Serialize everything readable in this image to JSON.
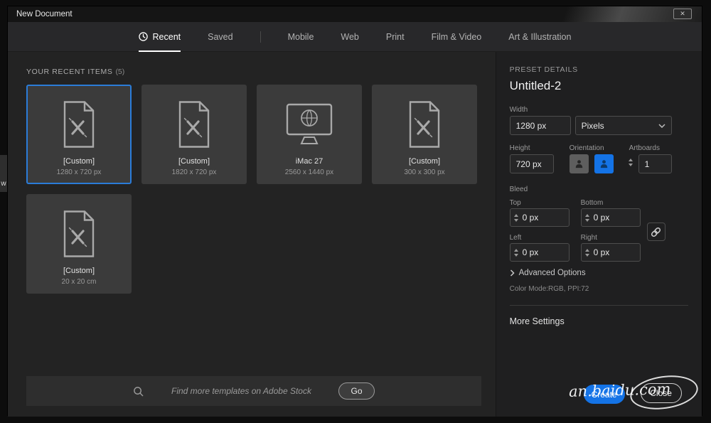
{
  "window": {
    "title": "New Document",
    "close_glyph": "✕"
  },
  "background": {
    "sliver_text": "w"
  },
  "tabs": [
    {
      "label": "Recent",
      "active": true,
      "icon": "clock"
    },
    {
      "label": "Saved",
      "divider_after": true
    },
    {
      "label": "Mobile"
    },
    {
      "label": "Web"
    },
    {
      "label": "Print"
    },
    {
      "label": "Film & Video"
    },
    {
      "label": "Art & Illustration"
    }
  ],
  "recent_section": {
    "heading": "YOUR RECENT ITEMS",
    "count": "(5)",
    "items": [
      {
        "name": "[Custom]",
        "size": "1280 x 720 px",
        "icon": "document",
        "selected": true
      },
      {
        "name": "[Custom]",
        "size": "1820 x 720 px",
        "icon": "document",
        "selected": false
      },
      {
        "name": "iMac 27",
        "size": "2560 x 1440 px",
        "icon": "monitor",
        "selected": false
      },
      {
        "name": "[Custom]",
        "size": "300 x 300 px",
        "icon": "document",
        "selected": false
      },
      {
        "name": "[Custom]",
        "size": "20 x 20 cm",
        "icon": "document",
        "selected": false
      }
    ]
  },
  "stock_search": {
    "placeholder": "Find more templates on Adobe Stock",
    "go_label": "Go"
  },
  "preset": {
    "heading": "PRESET DETAILS",
    "doc_name": "Untitled-2",
    "width_label": "Width",
    "width_value": "1280 px",
    "units_value": "Pixels",
    "height_label": "Height",
    "height_value": "720 px",
    "orientation_label": "Orientation",
    "artboards_label": "Artboards",
    "artboards_value": "1",
    "bleed_label": "Bleed",
    "bleed_top_label": "Top",
    "bleed_top_value": "0 px",
    "bleed_bottom_label": "Bottom",
    "bleed_bottom_value": "0 px",
    "bleed_left_label": "Left",
    "bleed_left_value": "0 px",
    "bleed_right_label": "Right",
    "bleed_right_value": "0 px",
    "advanced_label": "Advanced Options",
    "color_mode_text": "Color Mode:RGB, PPI:72",
    "more_settings_label": "More Settings",
    "create_label": "Create",
    "close_label": "Close"
  },
  "watermark": {
    "text": "an.baidu.com"
  },
  "colors": {
    "accent": "#1473e6",
    "selection_border": "#2b7cd8"
  }
}
